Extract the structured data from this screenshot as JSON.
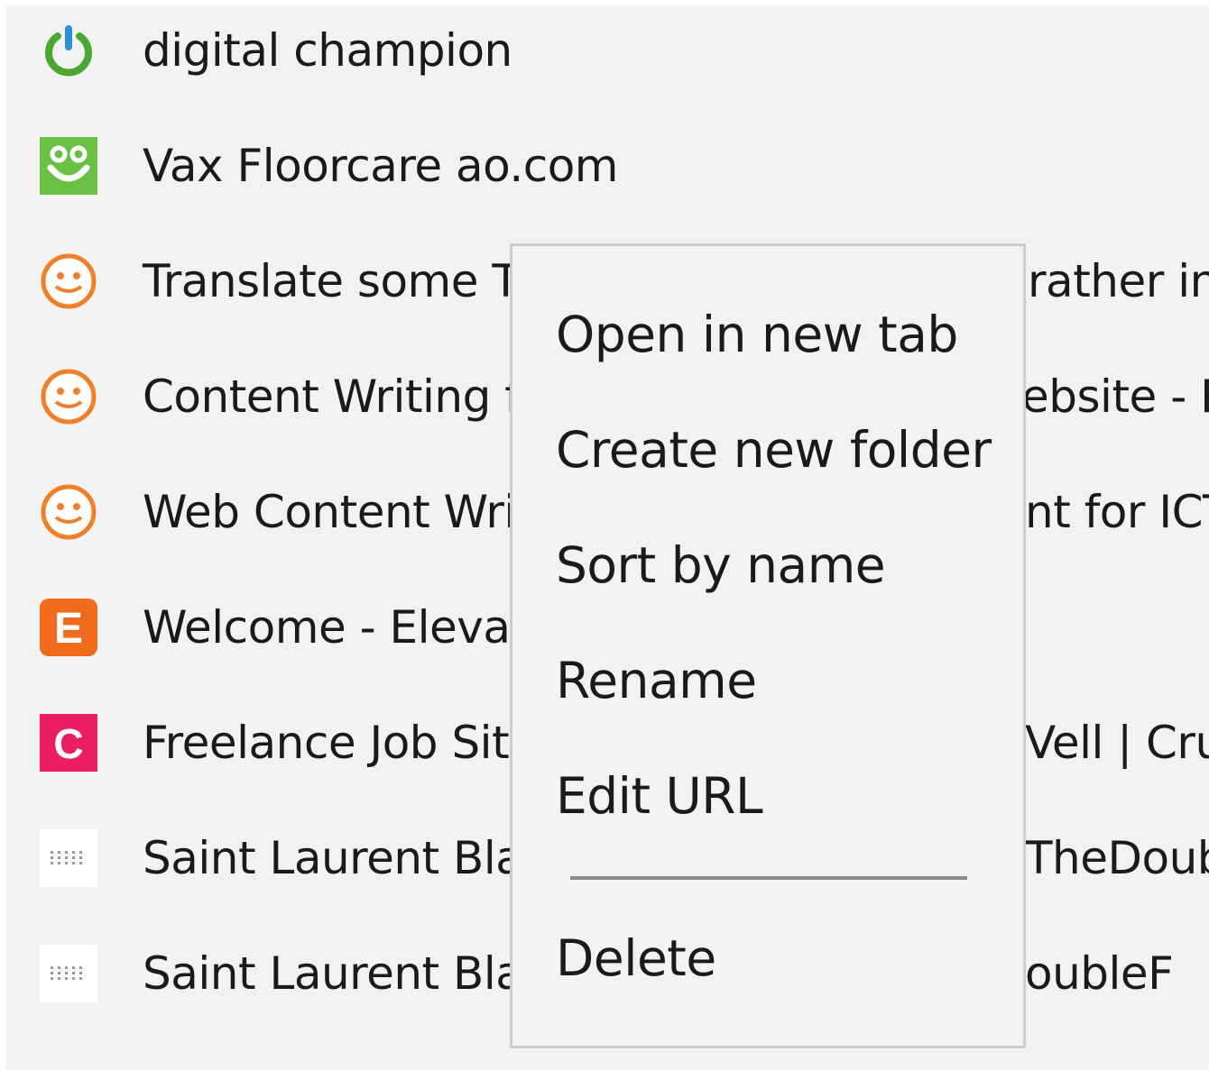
{
  "bookmarks": [
    {
      "label": "digital champion",
      "icon": "power-icon",
      "color": "#4aa832"
    },
    {
      "label": "Vax Floorcare ao.com",
      "icon": "ao-smile-icon",
      "color": "#6ac043"
    },
    {
      "label": "Translate some Th",
      "label_right": "rather in:",
      "icon": "freelancer-face-icon",
      "color": "#f07f2a"
    },
    {
      "label": "Content Writing fo",
      "label_right": "ebsite - P",
      "icon": "freelancer-face-icon",
      "color": "#f07f2a"
    },
    {
      "label": "Web Content Writ",
      "label_right": "nt for ICT",
      "icon": "freelancer-face-icon",
      "color": "#f07f2a"
    },
    {
      "label": "Welcome - Elevate",
      "icon": "elevate-e-icon",
      "color": "#f26a1b",
      "letter": "E"
    },
    {
      "label": "Freelance Job Site",
      "label_right": "Vell | Cru",
      "icon": "crunchbase-c-icon",
      "color": "#ea1f62",
      "letter": "C"
    },
    {
      "label": "Saint Laurent Blac",
      "label_right": "TheDoub",
      "icon": "dotted-grid-icon",
      "color": "#9a9a9a"
    },
    {
      "label": "Saint Laurent Blac",
      "label_right": "oubleF",
      "icon": "dotted-grid-icon",
      "color": "#9a9a9a"
    }
  ],
  "context_menu": {
    "open_new_tab": "Open in new tab",
    "create_folder": "Create new folder",
    "sort_by_name": "Sort by name",
    "rename": "Rename",
    "edit_url": "Edit URL",
    "delete": "Delete"
  }
}
